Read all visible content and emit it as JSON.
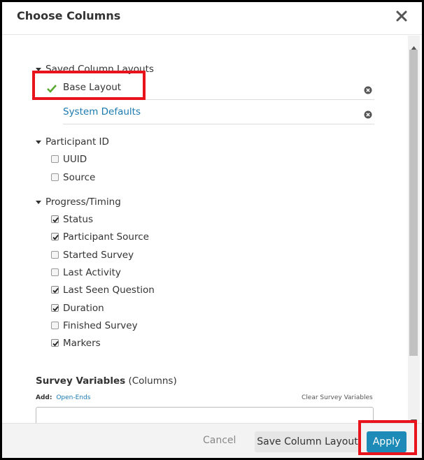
{
  "dialog": {
    "title": "Choose Columns",
    "close_icon": "close-icon"
  },
  "sections": {
    "saved_layouts": {
      "label": "Saved Column Layouts",
      "items": [
        {
          "label": "Base Layout",
          "active": true
        },
        {
          "label": "System Defaults",
          "active": false
        }
      ]
    },
    "participant_id": {
      "label": "Participant ID",
      "items": [
        {
          "label": "UUID",
          "checked": false
        },
        {
          "label": "Source",
          "checked": false
        }
      ]
    },
    "progress_timing": {
      "label": "Progress/Timing",
      "items": [
        {
          "label": "Status",
          "checked": true
        },
        {
          "label": "Participant Source",
          "checked": true
        },
        {
          "label": "Started Survey",
          "checked": false
        },
        {
          "label": "Last Activity",
          "checked": false
        },
        {
          "label": "Last Seen Question",
          "checked": true
        },
        {
          "label": "Duration",
          "checked": true
        },
        {
          "label": "Finished Survey",
          "checked": false
        },
        {
          "label": "Markers",
          "checked": true
        }
      ]
    }
  },
  "survey_variables": {
    "title": "Survey Variables",
    "title_suffix": "(Columns)",
    "add_label": "Add:",
    "add_link": "Open-Ends",
    "clear_link": "Clear Survey Variables",
    "select_value": ""
  },
  "footer": {
    "cancel_label": "Cancel",
    "save_label": "Save Column Layout",
    "apply_label": "Apply"
  },
  "colors": {
    "accent": "#1d8ab7",
    "link": "#1a7ab0",
    "highlight": "#e8131b",
    "check": "#5aa832"
  }
}
